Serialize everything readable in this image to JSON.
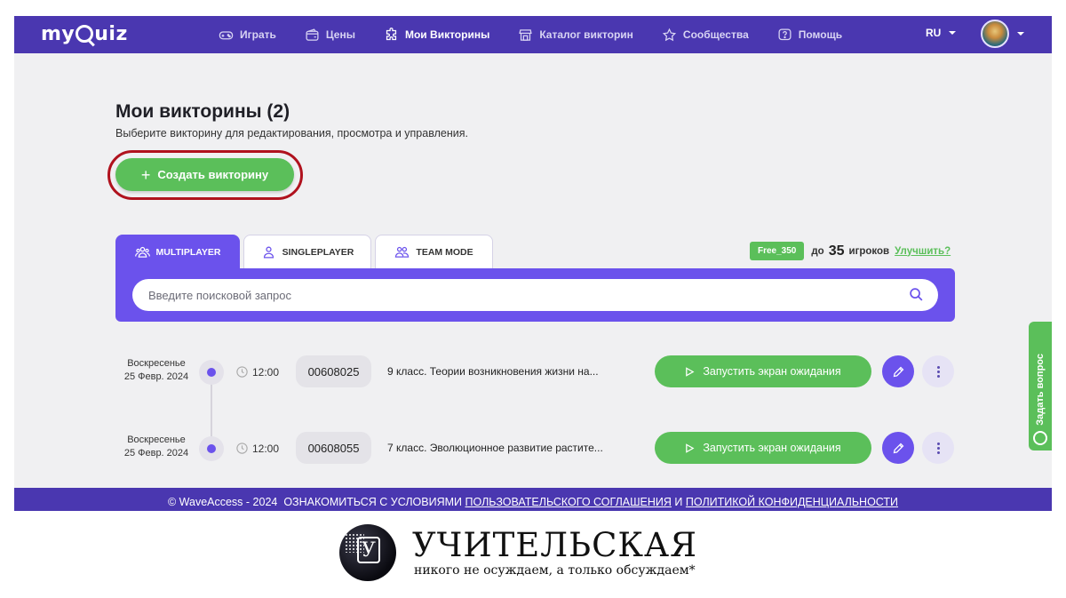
{
  "brand": {
    "logo_left": "my",
    "logo_right": "uiz"
  },
  "nav": {
    "items": [
      {
        "label": "Играть",
        "icon": "gamepad-icon"
      },
      {
        "label": "Цены",
        "icon": "wallet-icon"
      },
      {
        "label": "Мои Викторины",
        "icon": "puzzle-icon",
        "active": true
      },
      {
        "label": "Каталог викторин",
        "icon": "store-icon"
      },
      {
        "label": "Сообщества",
        "icon": "star-icon"
      },
      {
        "label": "Помощь",
        "icon": "help-icon"
      }
    ],
    "language": "RU"
  },
  "page": {
    "title": "Мои викторины (2)",
    "subtitle": "Выберите викторину для редактирования, просмотра и управления.",
    "create_button": "Создать викторину",
    "create_plus": "+"
  },
  "tabs": [
    {
      "label": "MULTIPLAYER",
      "active": true
    },
    {
      "label": "SINGLEPLAYER"
    },
    {
      "label": "TEAM MODE"
    }
  ],
  "plan": {
    "badge": "Free_350",
    "prefix": "до",
    "players": "35",
    "suffix": "игроков",
    "upgrade": "Улучшить?"
  },
  "search": {
    "placeholder": "Введите поисковой запрос"
  },
  "quizzes": [
    {
      "day": "Воскресенье",
      "date": "25 Февр. 2024",
      "time": "12:00",
      "code": "00608025",
      "name": "9 класс. Теории возникновения жизни на...",
      "launch": "Запустить экран ожидания"
    },
    {
      "day": "Воскресенье",
      "date": "25 Февр. 2024",
      "time": "12:00",
      "code": "00608055",
      "name": "7 класс. Эволюционное развитие растите...",
      "launch": "Запустить экран ожидания"
    }
  ],
  "feedback": {
    "label": "Задать вопрос"
  },
  "footer": {
    "copyright": "© WaveAccess - 2024",
    "prefix": "ОЗНАКОМИТЬСЯ С УСЛОВИЯМИ",
    "link1": "ПОЛЬЗОВАТЕЛЬСКОГО СОГЛАШЕНИЯ",
    "and": "И",
    "link2": "ПОЛИТИКОЙ КОНФИДЕНЦИАЛЬНОСТИ"
  },
  "watermark": {
    "title": "УЧИТЕЛЬСКАЯ",
    "subtitle": "никого не осуждаем, а только обсуждаем*",
    "logo_letter": "У"
  },
  "colors": {
    "nav_bg": "#4a37b0",
    "accent": "#6b52ec",
    "green": "#5bbf5a",
    "highlight_ring": "#b0121e"
  }
}
